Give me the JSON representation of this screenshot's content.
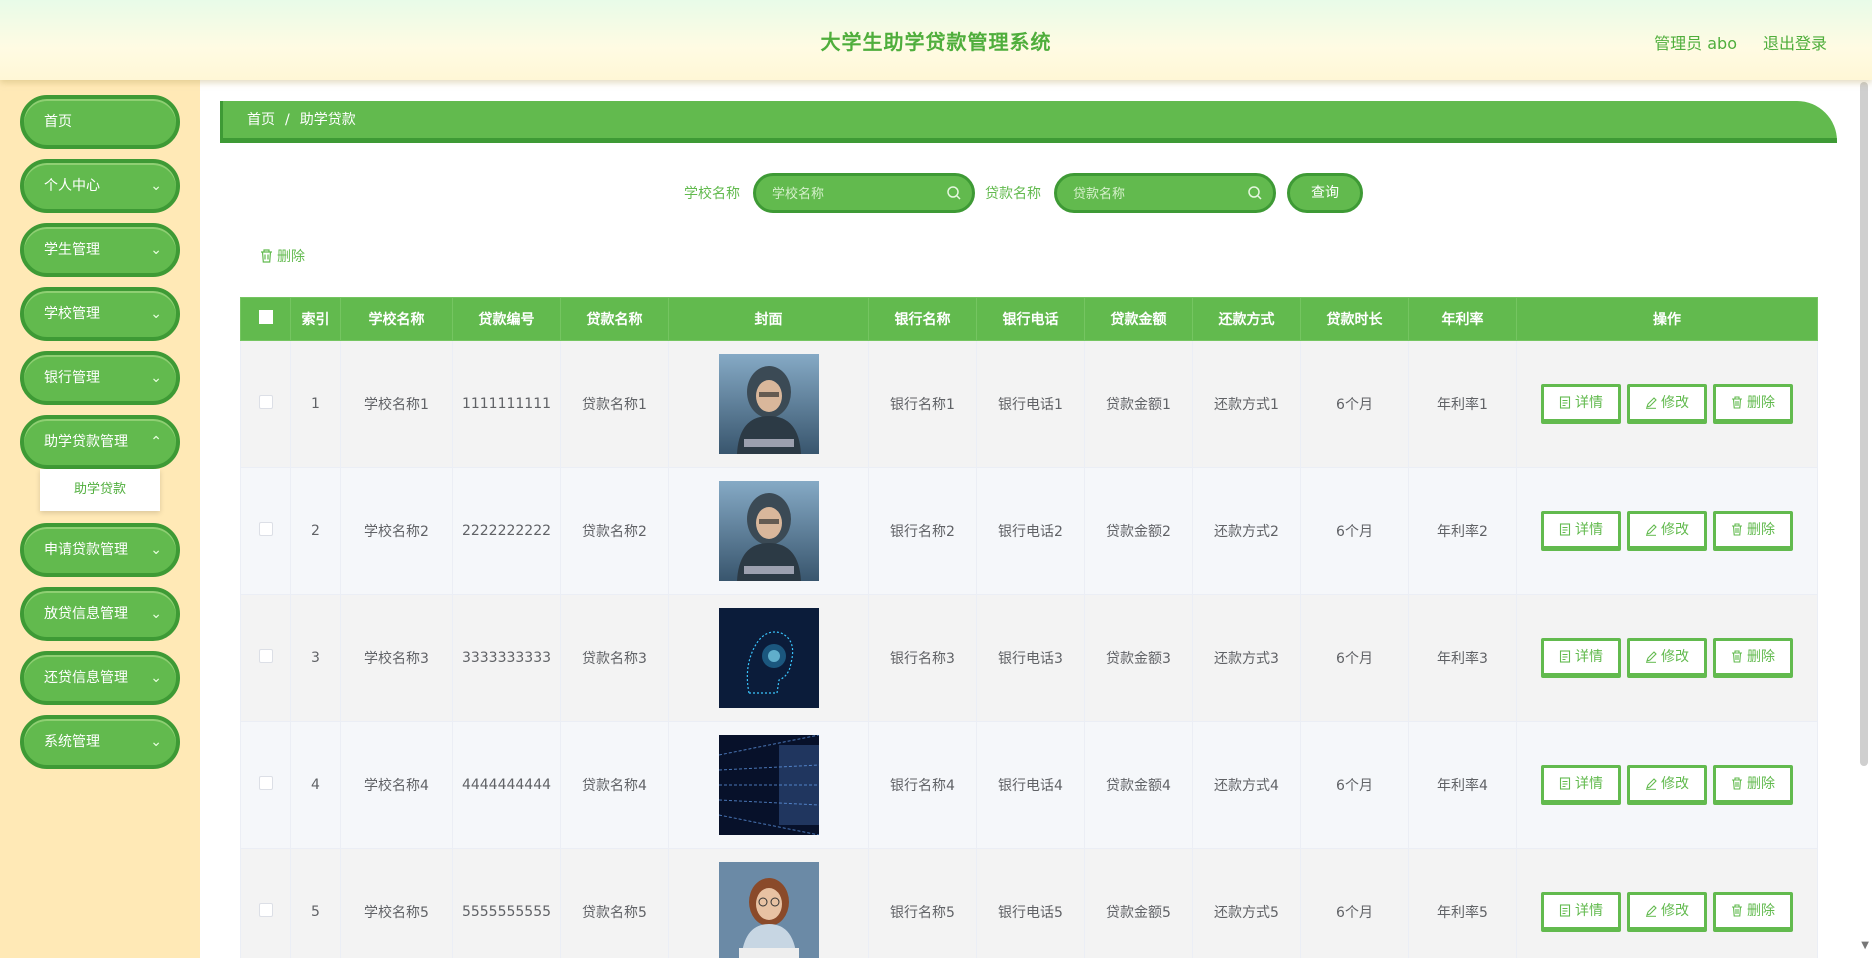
{
  "header": {
    "title": "大学生助学贷款管理系统",
    "user": "管理员 abo",
    "logout": "退出登录"
  },
  "sidebar": {
    "items": [
      {
        "label": "首页",
        "has_children": false
      },
      {
        "label": "个人中心",
        "has_children": true
      },
      {
        "label": "学生管理",
        "has_children": true
      },
      {
        "label": "学校管理",
        "has_children": true
      },
      {
        "label": "银行管理",
        "has_children": true
      },
      {
        "label": "助学贷款管理",
        "has_children": true,
        "expanded": true
      },
      {
        "label": "申请贷款管理",
        "has_children": true
      },
      {
        "label": "放贷信息管理",
        "has_children": true
      },
      {
        "label": "还贷信息管理",
        "has_children": true
      },
      {
        "label": "系统管理",
        "has_children": true
      }
    ],
    "sub_item": "助学贷款"
  },
  "breadcrumb": {
    "home": "首页",
    "separator": "/",
    "current": "助学贷款"
  },
  "search": {
    "school_label": "学校名称",
    "school_placeholder": "学校名称",
    "loan_label": "贷款名称",
    "loan_placeholder": "贷款名称",
    "query_label": "查询"
  },
  "toolbar": {
    "delete_label": "删除"
  },
  "table": {
    "headers": [
      "索引",
      "学校名称",
      "贷款编号",
      "贷款名称",
      "封面",
      "银行名称",
      "银行电话",
      "贷款金额",
      "还款方式",
      "贷款时长",
      "年利率",
      "操作"
    ],
    "rows": [
      {
        "index": "1",
        "school": "学校名称1",
        "loan_no": "1111111111",
        "loan_name": "贷款名称1",
        "cover_icon": "hooded-hacker-image",
        "bank": "银行名称1",
        "phone": "银行电话1",
        "amount": "贷款金额1",
        "repay": "还款方式1",
        "duration": "6个月",
        "rate": "年利率1"
      },
      {
        "index": "2",
        "school": "学校名称2",
        "loan_no": "2222222222",
        "loan_name": "贷款名称2",
        "cover_icon": "hooded-hacker-image",
        "bank": "银行名称2",
        "phone": "银行电话2",
        "amount": "贷款金额2",
        "repay": "还款方式2",
        "duration": "6个月",
        "rate": "年利率2"
      },
      {
        "index": "3",
        "school": "学校名称3",
        "loan_no": "3333333333",
        "loan_name": "贷款名称3",
        "cover_icon": "digital-head-image",
        "bank": "银行名称3",
        "phone": "银行电话3",
        "amount": "贷款金额3",
        "repay": "还款方式3",
        "duration": "6个月",
        "rate": "年利率3"
      },
      {
        "index": "4",
        "school": "学校名称4",
        "loan_no": "4444444444",
        "loan_name": "贷款名称4",
        "cover_icon": "code-tunnel-image",
        "bank": "银行名称4",
        "phone": "银行电话4",
        "amount": "贷款金额4",
        "repay": "还款方式4",
        "duration": "6个月",
        "rate": "年利率4"
      },
      {
        "index": "5",
        "school": "学校名称5",
        "loan_no": "5555555555",
        "loan_name": "贷款名称5",
        "cover_icon": "girl-keyboard-image",
        "bank": "银行名称5",
        "phone": "银行电话5",
        "amount": "贷款金额5",
        "repay": "还款方式5",
        "duration": "6个月",
        "rate": "年利率5"
      }
    ],
    "actions": {
      "detail": "详情",
      "edit": "修改",
      "delete": "删除"
    }
  },
  "colors": {
    "primary": "#62ba4e",
    "primary_dark": "#3e9a35",
    "sidebar_bg": "#ffe9b6"
  }
}
